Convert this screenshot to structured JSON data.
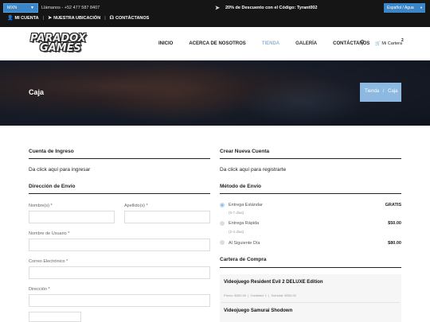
{
  "topbar": {
    "currency": "MXN",
    "phone": "Llámanos - +52 477 587 8407",
    "promo": "20% de Descuento con el Código: Tyrant002",
    "language_select": "Español / Agua",
    "links": [
      "MI CUENTA",
      "NUESTRA UBICACIÓN",
      "CONTÁCTANOS"
    ]
  },
  "header": {
    "logo_line1": "PARADOX",
    "logo_line2": "GAMES",
    "nav": [
      "INICIO",
      "ACERCA DE NOSOTROS",
      "TIENDA",
      "GALERÍA",
      "CONTÁCTANOS"
    ],
    "cart_label": "Mi Cartera",
    "cart_count": "2"
  },
  "hero": {
    "title": "Caja",
    "breadcrumb": [
      "Tienda",
      "Caja"
    ]
  },
  "left": {
    "login_title": "Cuenta de Ingreso",
    "login_text": "Da click aquí para ingresar",
    "address_title": "Dirección de Envío",
    "fields": {
      "first_name": "Nombre(s) *",
      "last_name": "Apellido(s) *",
      "username": "Nombre de Usuario *",
      "email": "Correo Electrónico *",
      "address": "Dirección *"
    }
  },
  "right": {
    "create_title": "Crear Nueva Cuenta",
    "create_text": "Da click aquí para registrarte",
    "shipping_title": "Método de Envío",
    "shipping": [
      {
        "name": "Entrega Estándar",
        "sub": "(5-7 días)",
        "price": "GRATIS",
        "selected": true
      },
      {
        "name": "Entrega Rápida",
        "sub": "(2-4 días)",
        "price": "$50.00",
        "selected": false
      },
      {
        "name": "Al Siguiente Día",
        "sub": "",
        "price": "$80.00",
        "selected": false
      }
    ],
    "cart_title": "Cartera de Compra",
    "items": [
      {
        "name": "Videojuego Resident Evil 2 DELUXE Edition",
        "price": "Precio: $000.00",
        "qty": "Cantidad: 1",
        "subtotal": "Subtotal: $000.00"
      },
      {
        "name": "Videojuego Samurai Shodown"
      }
    ]
  },
  "colors": {
    "accent": "#8db8e0",
    "topbar_bg": "#151515",
    "select_bg": "#3b86c8"
  }
}
